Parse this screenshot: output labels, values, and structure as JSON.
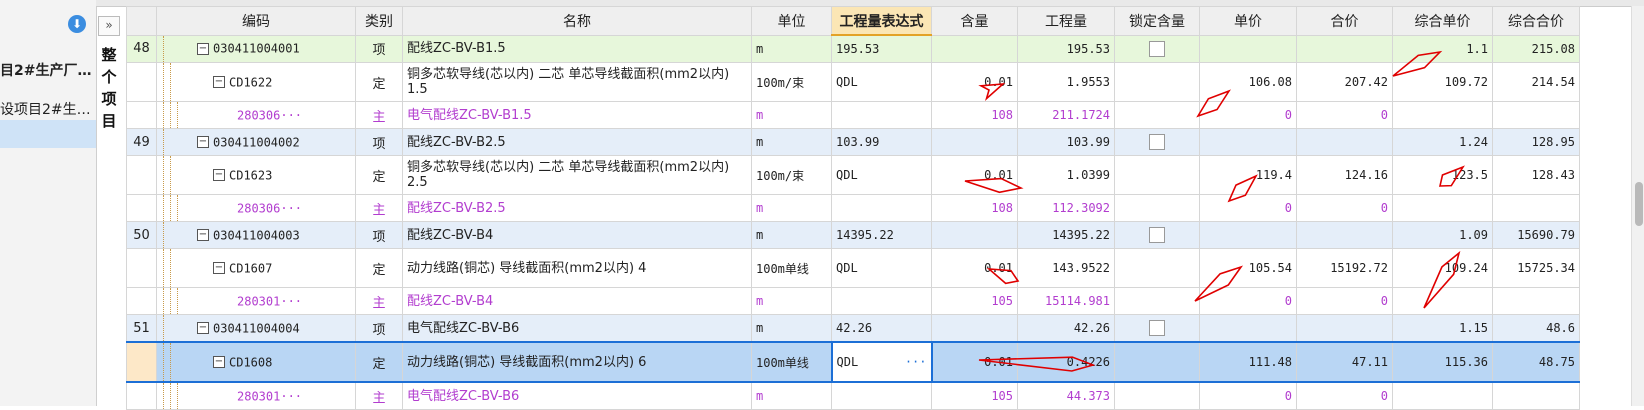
{
  "sidebar": {
    "items": [
      "目2#生产厂…",
      "设项目2#生…"
    ]
  },
  "panel": {
    "collapse_glyph": "»",
    "vertical_title": "整个项目"
  },
  "columns": [
    "编码",
    "类别",
    "名称",
    "单位",
    "工程量表达式",
    "含量",
    "工程量",
    "锁定含量",
    "单价",
    "合价",
    "综合单价",
    "综合合价"
  ],
  "rows": [
    {
      "seq": "48",
      "code": "030411004001",
      "cat": "项",
      "name": "配线ZC-BV-B1.5",
      "unit": "m",
      "expr": "195.53",
      "content": "",
      "qty": "195.53",
      "lock": true,
      "price": "",
      "total": "",
      "unit_price": "1.1",
      "sum": "215.08",
      "type": "qing"
    },
    {
      "seq": "",
      "code": "CD1622",
      "cat": "定",
      "name": "铜多芯软导线(芯以内) 二芯 单芯导线截面积(mm2以内) 1.5",
      "unit": "100m/束",
      "expr": "QDL",
      "content": "0.01",
      "qty": "1.9553",
      "lock": false,
      "price": "106.08",
      "total": "207.42",
      "unit_price": "109.72",
      "sum": "214.54",
      "type": "ding"
    },
    {
      "seq": "",
      "code": "280306···",
      "cat": "主",
      "name": "电气配线ZC-BV-B1.5",
      "unit": "m",
      "expr": "",
      "content": "108",
      "qty": "211.1724",
      "lock": false,
      "price": "0",
      "total": "0",
      "unit_price": "",
      "sum": "",
      "type": "zhu"
    },
    {
      "seq": "49",
      "code": "030411004002",
      "cat": "项",
      "name": "配线ZC-BV-B2.5",
      "unit": "m",
      "expr": "103.99",
      "content": "",
      "qty": "103.99",
      "lock": true,
      "price": "",
      "total": "",
      "unit_price": "1.24",
      "sum": "128.95",
      "type": "xiang"
    },
    {
      "seq": "",
      "code": "CD1623",
      "cat": "定",
      "name": "铜多芯软导线(芯以内) 二芯 单芯导线截面积(mm2以内) 2.5",
      "unit": "100m/束",
      "expr": "QDL",
      "content": "0.01",
      "qty": "1.0399",
      "lock": false,
      "price": "119.4",
      "total": "124.16",
      "unit_price": "123.5",
      "sum": "128.43",
      "type": "ding"
    },
    {
      "seq": "",
      "code": "280306···",
      "cat": "主",
      "name": "配线ZC-BV-B2.5",
      "unit": "m",
      "expr": "",
      "content": "108",
      "qty": "112.3092",
      "lock": false,
      "price": "0",
      "total": "0",
      "unit_price": "",
      "sum": "",
      "type": "zhu"
    },
    {
      "seq": "50",
      "code": "030411004003",
      "cat": "项",
      "name": "配线ZC-BV-B4",
      "unit": "m",
      "expr": "14395.22",
      "content": "",
      "qty": "14395.22",
      "lock": true,
      "price": "",
      "total": "",
      "unit_price": "1.09",
      "sum": "15690.79",
      "type": "xiang"
    },
    {
      "seq": "",
      "code": "CD1607",
      "cat": "定",
      "name": "动力线路(铜芯) 导线截面积(mm2以内) 4",
      "unit": "100m单线",
      "expr": "QDL",
      "content": "0.01",
      "qty": "143.9522",
      "lock": false,
      "price": "105.54",
      "total": "15192.72",
      "unit_price": "109.24",
      "sum": "15725.34",
      "type": "ding"
    },
    {
      "seq": "",
      "code": "280301···",
      "cat": "主",
      "name": "配线ZC-BV-B4",
      "unit": "m",
      "expr": "",
      "content": "105",
      "qty": "15114.981",
      "lock": false,
      "price": "0",
      "total": "0",
      "unit_price": "",
      "sum": "",
      "type": "zhu"
    },
    {
      "seq": "51",
      "code": "030411004004",
      "cat": "项",
      "name": "电气配线ZC-BV-B6",
      "unit": "m",
      "expr": "42.26",
      "content": "",
      "qty": "42.26",
      "lock": true,
      "price": "",
      "total": "",
      "unit_price": "1.15",
      "sum": "48.6",
      "type": "xiang"
    },
    {
      "seq": "",
      "code": "CD1608",
      "cat": "定",
      "name": "动力线路(铜芯) 导线截面积(mm2以内) 6",
      "unit": "100m单线",
      "expr": "QDL",
      "content": "0.01",
      "qty": "0.4226",
      "lock": false,
      "price": "111.48",
      "total": "47.11",
      "unit_price": "115.36",
      "sum": "48.75",
      "type": "sel"
    },
    {
      "seq": "",
      "code": "280301···",
      "cat": "主",
      "name": "电气配线ZC-BV-B6",
      "unit": "m",
      "expr": "",
      "content": "105",
      "qty": "44.373",
      "lock": false,
      "price": "0",
      "total": "0",
      "unit_price": "",
      "sum": "",
      "type": "zhu"
    }
  ],
  "selected_cell_ellipsis": "···",
  "colors": {
    "accent": "#1c6fd6",
    "material_text": "#b23dcf",
    "annotation_arrow": "#e00000",
    "item_row_bg": "#e5eef9",
    "first_item_row_bg": "#e7f7db"
  }
}
